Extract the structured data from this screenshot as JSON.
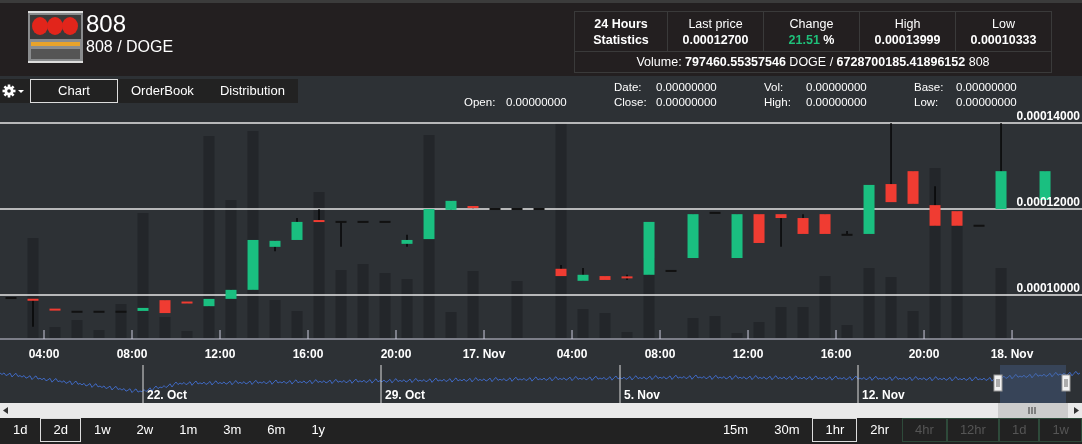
{
  "header": {
    "title": "808",
    "pair": "808 / DOGE"
  },
  "stats": {
    "heading": "24 Hours Statistics",
    "columns": [
      {
        "label": "Last price",
        "value": "0.00012700",
        "kind": "plain"
      },
      {
        "label": "Change",
        "value": "21.51",
        "unit": "%",
        "kind": "change"
      },
      {
        "label": "High",
        "value": "0.00013999",
        "kind": "plain"
      },
      {
        "label": "Low",
        "value": "0.00010333",
        "kind": "plain"
      }
    ],
    "volume": "Volume: **797460.55357546** DOGE / **6728700185.41896152** 808"
  },
  "tabs": [
    {
      "label": "Chart",
      "selected": true
    },
    {
      "label": "OrderBook",
      "selected": false
    },
    {
      "label": "Distribution",
      "selected": false
    }
  ],
  "readings": [
    [
      {
        "label": "Open:",
        "value": "0.00000000"
      }
    ],
    [
      {
        "label": "Date:",
        "value": "0.00000000"
      },
      {
        "label": "Close:",
        "value": "0.00000000"
      }
    ],
    [
      {
        "label": "Vol:",
        "value": "0.00000000"
      },
      {
        "label": "High:",
        "value": "0.00000000"
      }
    ],
    [
      {
        "label": "Base:",
        "value": "0.00000000"
      },
      {
        "label": "Low:",
        "value": "0.00000000"
      }
    ]
  ],
  "chart": {
    "chart_data": {
      "type": "candlestick",
      "x": [
        2.5,
        3.5,
        4.5,
        5.5,
        6.5,
        7.5,
        8.5,
        9.5,
        10.5,
        11.5,
        12.5,
        13.5,
        14.5,
        15.5,
        16.5,
        17.5,
        18.5,
        19.5,
        20.5,
        21.5,
        22.5,
        23.5,
        24.5,
        25.5,
        26.5,
        27.5,
        28.5,
        29.5,
        30.5,
        31.5,
        32.5,
        33.5,
        34.5,
        35.5,
        36.5,
        37.5,
        38.5,
        39.5,
        40.5,
        41.5,
        42.5,
        43.5,
        44.5,
        45.5,
        46.5,
        47.5,
        49.5
      ],
      "ohlc": [
        [
          9.93e-05,
          9.93e-05,
          9.93e-05,
          9.93e-05
        ],
        [
          9.91e-05,
          9.91e-05,
          9.26e-05,
          9.87e-05
        ],
        [
          9.67e-05,
          9.67e-05,
          9.65e-05,
          9.65e-05
        ],
        [
          9.61e-05,
          9.61e-05,
          9.61e-05,
          9.61e-05
        ],
        [
          9.61e-05,
          9.61e-05,
          9.61e-05,
          9.61e-05
        ],
        [
          9.61e-05,
          9.61e-05,
          9.61e-05,
          9.61e-05
        ],
        [
          9.63e-05,
          9.7e-05,
          9.63e-05,
          9.7e-05
        ],
        [
          9.88e-05,
          9.88e-05,
          9.58e-05,
          9.58e-05
        ],
        [
          9.84e-05,
          9.84e-05,
          9.81e-05,
          9.81e-05
        ],
        [
          9.74e-05,
          9.91e-05,
          9.74e-05,
          9.91e-05
        ],
        [
          9.91e-05,
          0.0001012,
          9.91e-05,
          0.0001012
        ],
        [
          0.0001012,
          0.0001128,
          0.0001012,
          0.0001128
        ],
        [
          0.0001112,
          0.0001126,
          0.0001102,
          0.0001126
        ],
        [
          0.0001128,
          0.0001179,
          0.0001128,
          0.000117
        ],
        [
          0.0001174,
          0.00012,
          0.000117,
          0.000117
        ],
        [
          0.000117,
          0.000117,
          0.0001112,
          0.000117
        ],
        [
          0.000117,
          0.000117,
          0.000117,
          0.000117
        ],
        [
          0.000117,
          0.000117,
          0.000117,
          0.000117
        ],
        [
          0.0001119,
          0.000114,
          0.0001112,
          0.0001128
        ],
        [
          0.000113,
          0.00012,
          0.000113,
          0.00012
        ],
        [
          0.0001198,
          0.0001219,
          0.0001198,
          0.0001219
        ],
        [
          0.0001207,
          0.0001207,
          0.0001202,
          0.0001202
        ],
        [
          0.00012,
          0.00012,
          0.00012,
          0.00012
        ],
        [
          0.00012,
          0.00012,
          0.00012,
          0.00012
        ],
        [
          0.00012,
          0.00012,
          0.00012,
          0.00012
        ],
        [
          0.0001061,
          0.000107,
          0.0001044,
          0.0001044
        ],
        [
          0.0001033,
          0.0001063,
          0.0001033,
          0.0001047
        ],
        [
          0.0001044,
          0.0001044,
          0.0001035,
          0.0001035
        ],
        [
          0.0001042,
          0.0001047,
          0.0001035,
          0.000104
        ],
        [
          0.0001047,
          0.000117,
          0.0001047,
          0.000117
        ],
        [
          0.0001056,
          0.0001056,
          0.0001056,
          0.0001056
        ],
        [
          0.0001086,
          0.0001188,
          0.0001086,
          0.0001188
        ],
        [
          0.0001191,
          0.0001191,
          0.0001191,
          0.0001191
        ],
        [
          0.0001086,
          0.0001188,
          0.0001086,
          0.0001188
        ],
        [
          0.0001188,
          0.0001188,
          0.0001121,
          0.0001121
        ],
        [
          0.0001188,
          0.0001188,
          0.0001112,
          0.0001179
        ],
        [
          0.0001179,
          0.0001188,
          0.0001142,
          0.0001142
        ],
        [
          0.0001188,
          0.0001188,
          0.0001142,
          0.0001142
        ],
        [
          0.000114,
          0.0001149,
          0.000114,
          0.000114
        ],
        [
          0.0001142,
          0.0001256,
          0.0001142,
          0.0001256
        ],
        [
          0.0001258,
          0.00014,
          0.0001216,
          0.0001216
        ],
        [
          0.0001288,
          0.0001288,
          0.0001212,
          0.0001212
        ],
        [
          0.0001209,
          0.0001253,
          0.0001161,
          0.0001161
        ],
        [
          0.0001195,
          0.0001195,
          0.0001161,
          0.0001161
        ],
        [
          0.0001161,
          0.0001161,
          0.0001161,
          0.0001161
        ],
        [
          0.00012,
          0.00014,
          0.00012,
          0.0001288
        ],
        [
          0.0001221,
          0.0001288,
          0.0001221,
          0.0001288
        ]
      ],
      "yticks": [
        {
          "value": 0.00014,
          "label": "0.00014000"
        },
        {
          "value": 0.00012,
          "label": "0.00012000"
        },
        {
          "value": 0.0001,
          "label": "0.00010000"
        }
      ],
      "xlim": [
        2,
        51.18
      ],
      "ylim": [
        8.977e-05,
        0.00014
      ],
      "xticks": [
        {
          "value": 4,
          "label": "04:00"
        },
        {
          "value": 8,
          "label": "08:00"
        },
        {
          "value": 12,
          "label": "12:00"
        },
        {
          "value": 16,
          "label": "16:00"
        },
        {
          "value": 20,
          "label": "20:00"
        },
        {
          "value": 24,
          "label": "17. Nov"
        },
        {
          "value": 48,
          "label": "18. Nov"
        }
      ],
      "grid": true
    },
    "second_day_labels": [
      "04:00",
      "08:00",
      "12:00",
      "16:00",
      "20:00"
    ]
  },
  "navigator": {
    "labels": [
      "22. Oct",
      "29. Oct",
      "5. Nov",
      "12. Nov"
    ]
  },
  "ranges": [
    {
      "label": "1d",
      "selected": false
    },
    {
      "label": "2d",
      "selected": true
    },
    {
      "label": "1w",
      "selected": false
    },
    {
      "label": "2w",
      "selected": false
    },
    {
      "label": "1m",
      "selected": false
    },
    {
      "label": "3m",
      "selected": false
    },
    {
      "label": "6m",
      "selected": false
    },
    {
      "label": "1y",
      "selected": false
    }
  ],
  "intervals": [
    {
      "label": "15m",
      "selected": false,
      "disabled": false
    },
    {
      "label": "30m",
      "selected": false,
      "disabled": false
    },
    {
      "label": "1hr",
      "selected": true,
      "disabled": false
    },
    {
      "label": "2hr",
      "selected": false,
      "disabled": false
    },
    {
      "label": "4hr",
      "selected": false,
      "disabled": true
    },
    {
      "label": "12hr",
      "selected": false,
      "disabled": true
    },
    {
      "label": "1d",
      "selected": false,
      "disabled": true
    },
    {
      "label": "1w",
      "selected": false,
      "disabled": true
    }
  ]
}
